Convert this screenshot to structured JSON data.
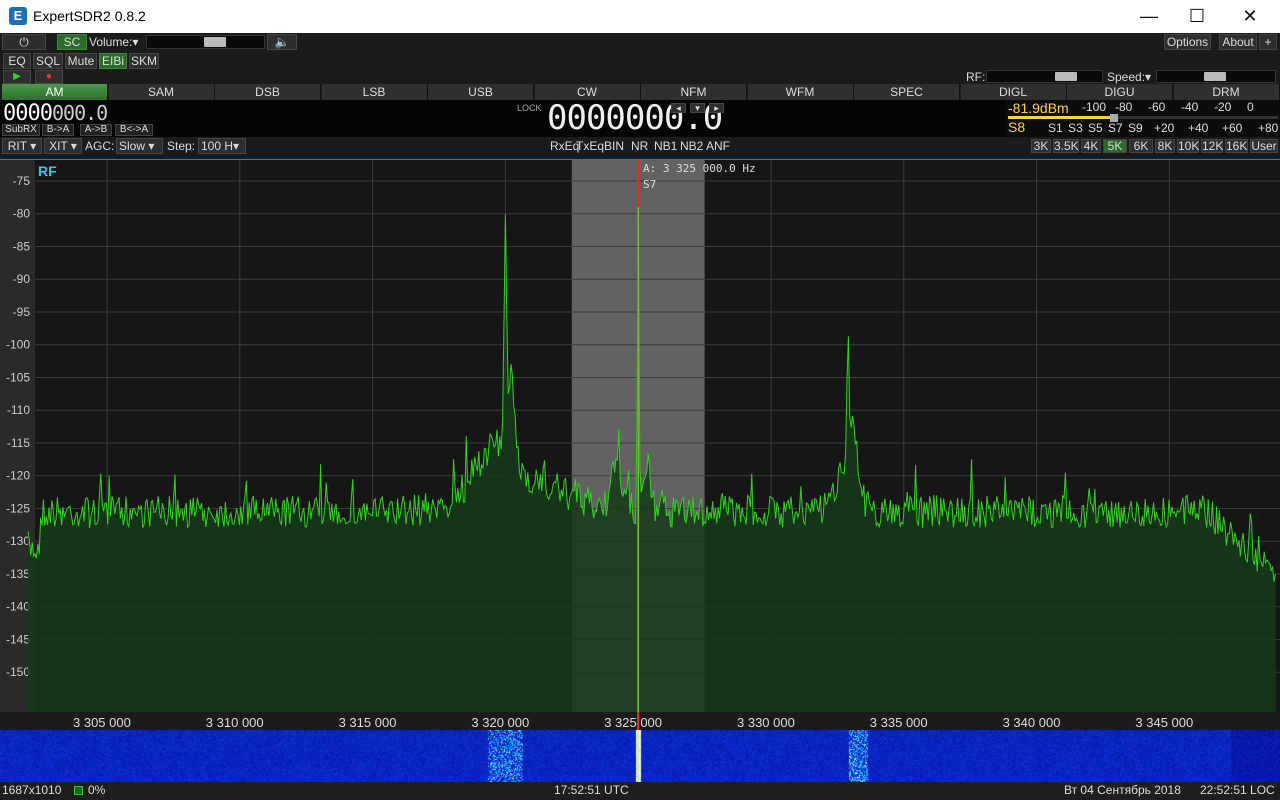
{
  "window": {
    "title": "ExpertSDR2 0.8.2",
    "minimize": "—",
    "maximize": "☐",
    "close": "✕",
    "app_icon": "E"
  },
  "toolbar": {
    "power_icon": "⏻",
    "sc": "SC",
    "volume_label": "Volume:",
    "volume_arrow": "▾",
    "volume_level": 0.5,
    "speaker_icon": "🔈",
    "options": "Options",
    "about": "About",
    "about_icon": "+"
  },
  "row2": {
    "eq": "EQ",
    "sql": "SQL",
    "mute": "Mute",
    "eibi": "EIBi",
    "skm": "SKM"
  },
  "row3": {
    "play": "▶",
    "record": "●",
    "rf_label": "RF:",
    "speed_label": "Speed:",
    "speed_arrow": "▾"
  },
  "modes": [
    "AM",
    "SAM",
    "DSB",
    "LSB",
    "USB",
    "CW",
    "NFM",
    "WFM",
    "SPEC",
    "DIGL",
    "DIGU",
    "DRM"
  ],
  "active_mode": "AM",
  "vfo": {
    "subrx_display": "0000",
    "sub_freq": "000.0",
    "subrx": "SubRX",
    "b_to_a": "B->A",
    "a_to_b": "A->B",
    "swap": "B<->A",
    "lock": "LOCK",
    "main_display": "0000000.0",
    "arrow_left": "◂",
    "arrow_down": "▾",
    "arrow_right": "▸"
  },
  "meter": {
    "dbm": "-81.9dBm",
    "scale_top": [
      "-100",
      "-80",
      "-60",
      "-40",
      "-20",
      "0"
    ],
    "s_value": "S8",
    "scale_bottom": [
      "S1",
      "S3",
      "S5",
      "S7",
      "S9",
      "+20",
      "+40",
      "+60",
      "+80"
    ]
  },
  "controls": {
    "rit": "RIT",
    "xit": "XIT",
    "agc_label": "AGC:",
    "agc_value": "Slow",
    "step_label": "Step:",
    "step_value": "100 H",
    "dropdown": "▾",
    "rxeq": "RxEq",
    "txeq": "TxEq",
    "bin": "BIN",
    "nr": "NR",
    "nb1": "NB1",
    "nb2": "NB2",
    "anf": "ANF"
  },
  "bandwidths": [
    "3K",
    "3.5K",
    "4K",
    "5K",
    "6K",
    "8K",
    "10K",
    "12K",
    "16K",
    "User"
  ],
  "active_bandwidth": "5K",
  "spectrum": {
    "label": "RF",
    "marker_freq": "A: 3 325 000.0 Hz",
    "marker_s": "S7",
    "db_labels": [
      "-75",
      "-80",
      "-85",
      "-90",
      "-95",
      "-100",
      "-105",
      "-110",
      "-115",
      "-120",
      "-125",
      "-130",
      "-135",
      "-140",
      "-145",
      "-150"
    ],
    "freq_labels": [
      "3 305 000",
      "3 310 000",
      "3 315 000",
      "3 320 000",
      "3 325 000",
      "3 330 000",
      "3 335 000",
      "3 340 000",
      "3 345 000"
    ]
  },
  "statusbar": {
    "resolution": "1687x1010",
    "cpu": "0%",
    "utc": "17:52:51 UTC",
    "date": "Вт 04 Сентябрь 2018",
    "local": "22:52:51 LOC"
  },
  "colors": {
    "accent_green": "#2a6a2a",
    "trace": "#32d21e",
    "fill": "#16391a",
    "marker": "#ff2020",
    "passband": "#6a6a6a"
  }
}
